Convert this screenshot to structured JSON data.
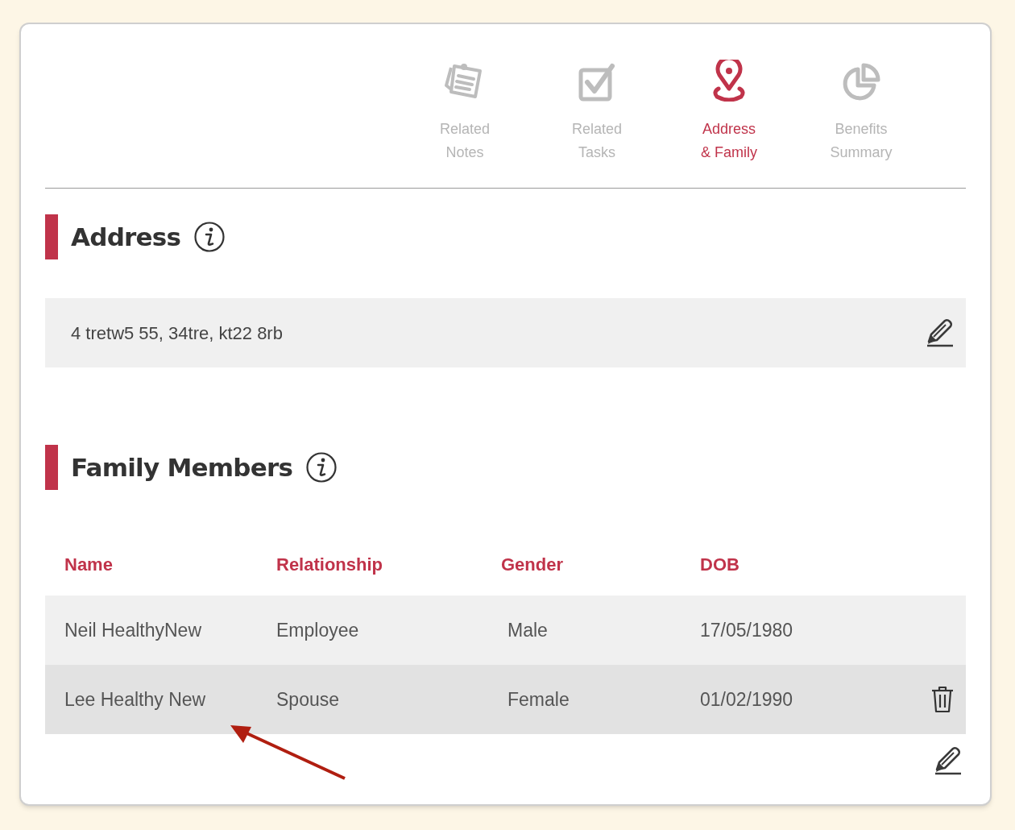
{
  "tabs": [
    {
      "label_lines": [
        "Related",
        "Notes"
      ],
      "selected": false
    },
    {
      "label_lines": [
        "Related",
        "Tasks"
      ],
      "selected": false
    },
    {
      "label_lines": [
        "Address",
        "& Family"
      ],
      "selected": true
    },
    {
      "label_lines": [
        "Benefits",
        "Summary"
      ],
      "selected": false
    }
  ],
  "address_section": {
    "title": "Address",
    "address": "4 tretw5 55, 34tre, kt22 8rb"
  },
  "family_section": {
    "title": "Family Members",
    "columns": [
      "Name",
      "Relationship",
      "Gender",
      "DOB"
    ],
    "rows": [
      {
        "cells": [
          "Neil HealthyNew",
          "Employee",
          "Male",
          "17/05/1980"
        ],
        "selected": false
      },
      {
        "cells": [
          "Lee Healthy New",
          "Spouse",
          "Female",
          "01/02/1990"
        ],
        "selected": true
      }
    ]
  }
}
